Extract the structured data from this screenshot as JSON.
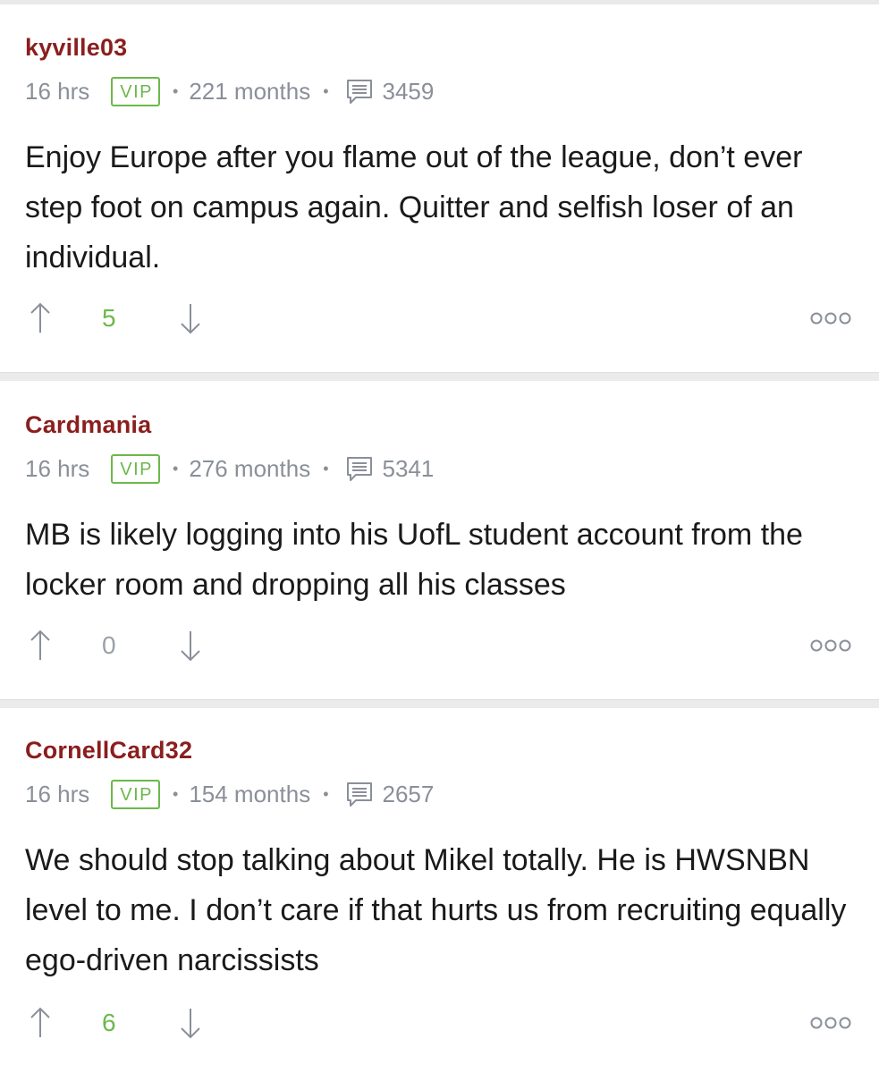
{
  "comments": [
    {
      "username": "kyville03",
      "time": "16 hrs",
      "badge": "VIP",
      "membership": "221 months",
      "post_count": "3459",
      "text": "Enjoy Europe after you flame out of the league, don’t ever step foot on campus again. Quitter and selfish loser of an individual.",
      "votes": "5"
    },
    {
      "username": "Cardmania",
      "time": "16 hrs",
      "badge": "VIP",
      "membership": "276 months",
      "post_count": "5341",
      "text": "MB is likely logging into his UofL student account from the locker room and dropping all his classes",
      "votes": "0"
    },
    {
      "username": "CornellCard32",
      "time": "16 hrs",
      "badge": "VIP",
      "membership": "154 months",
      "post_count": "2657",
      "text": "We should stop talking about Mikel totally. He is HWSNBN level to me. I don’t care if that hurts us from recruiting equally ego-driven narcissists",
      "votes": "6"
    }
  ],
  "separator": "•",
  "icons": {
    "posts": "message-icon",
    "upvote": "arrow-up-icon",
    "downvote": "arrow-down-icon",
    "more": "more-options-icon"
  },
  "colors": {
    "username": "#8b1e1e",
    "vip_badge": "#6cb84a",
    "meta_text": "#8a8f99",
    "body_text": "#1a1a1a",
    "vote_positive": "#6cb84a",
    "vote_zero": "#9aa0a8",
    "divider": "#ebebeb"
  }
}
